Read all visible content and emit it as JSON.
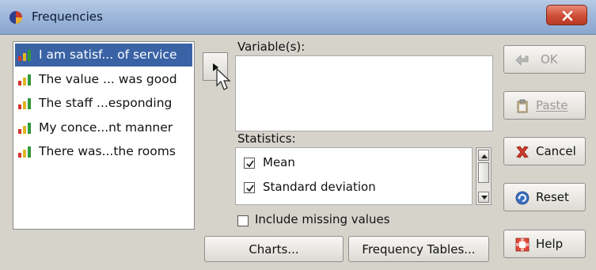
{
  "window": {
    "title": "Frequencies"
  },
  "source_list": {
    "items": [
      {
        "label": "I am satisf... of service",
        "selected": true
      },
      {
        "label": "The value ... was good",
        "selected": false
      },
      {
        "label": "The staff ...esponding",
        "selected": false
      },
      {
        "label": "My conce...nt manner",
        "selected": false
      },
      {
        "label": "There was...the rooms",
        "selected": false
      }
    ]
  },
  "variables": {
    "label": "Variable(s):"
  },
  "statistics": {
    "label": "Statistics:",
    "items": [
      {
        "label": "Mean",
        "checked": true
      },
      {
        "label": "Standard deviation",
        "checked": true
      }
    ]
  },
  "include_missing": {
    "label": "Include missing values",
    "checked": false
  },
  "buttons": {
    "ok": "OK",
    "paste": "Paste",
    "cancel": "Cancel",
    "reset": "Reset",
    "help": "Help",
    "charts": "Charts...",
    "frequency_tables": "Frequency Tables..."
  },
  "icons": {
    "app": "app-icon",
    "variable": "scale-variable-icon",
    "move": "move-right-arrow-icon",
    "ok": "ok-arrow-icon",
    "paste": "clipboard-icon",
    "cancel": "cancel-x-icon",
    "reset": "reset-icon",
    "help": "help-lifebuoy-icon",
    "close": "close-icon"
  },
  "colors": {
    "selection": "#3a63a6",
    "titlebar": "#9fb7da",
    "close_button": "#cf4d36",
    "disabled_text": "#9c9c9c"
  }
}
